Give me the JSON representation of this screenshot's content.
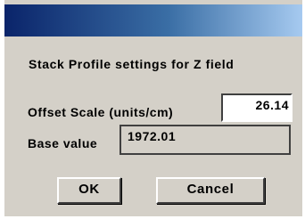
{
  "dialog": {
    "prompt": "Stack Profile settings for Z field",
    "offset_scale": {
      "label": "Offset Scale (units/cm)",
      "value": "26.14"
    },
    "base_value": {
      "label": "Base value",
      "value": "1972.01"
    },
    "buttons": {
      "ok": "OK",
      "cancel": "Cancel"
    }
  },
  "colors": {
    "face": "#d4d0c8",
    "titlebar_start": "#0a246a",
    "titlebar_end": "#a6caf0",
    "field_background": "#ffffff"
  }
}
